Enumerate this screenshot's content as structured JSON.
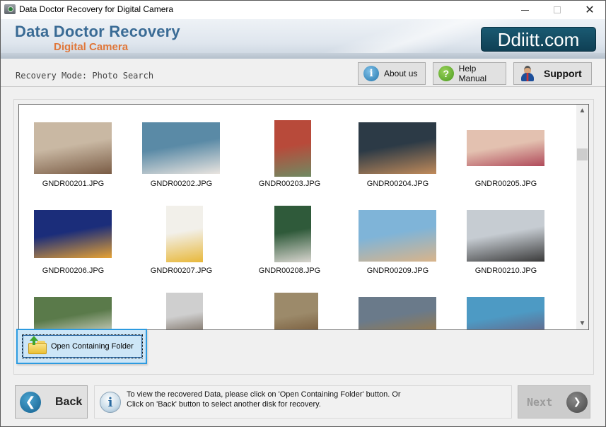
{
  "window": {
    "title": "Data Doctor Recovery for Digital Camera",
    "controls": {
      "minimize": "minimize",
      "maximize": "maximize",
      "close": "✕"
    }
  },
  "banner": {
    "title": "Data Doctor Recovery",
    "subtitle": "Digital Camera",
    "logo": "Ddiitt.com",
    "colors": {
      "title": "#3a6b95",
      "subtitle": "#e0773a",
      "logo_bg": "#134a61"
    }
  },
  "modebar": {
    "label": "Recovery Mode: Photo Search",
    "buttons": {
      "about": {
        "label": "About us",
        "icon": "info-icon",
        "glyph": "i"
      },
      "help": {
        "label": "Help Manual",
        "icon": "question-icon",
        "glyph": "?"
      },
      "support": {
        "label": "Support",
        "icon": "support-person-icon"
      }
    }
  },
  "gallery": {
    "items": [
      {
        "name": "GNDR00201.JPG",
        "scene": "group cheering in office"
      },
      {
        "name": "GNDR00202.JPG",
        "scene": "photographer on beach by lake"
      },
      {
        "name": "GNDR00203.JPG",
        "scene": "woman near red building"
      },
      {
        "name": "GNDR00204.JPG",
        "scene": "friends smiling selfie"
      },
      {
        "name": "GNDR00205.JPG",
        "scene": "four women selfie"
      },
      {
        "name": "GNDR00206.JPG",
        "scene": "city skyline at night"
      },
      {
        "name": "GNDR00207.JPG",
        "scene": "child with yay balloons"
      },
      {
        "name": "GNDR00208.JPG",
        "scene": "christmas tree"
      },
      {
        "name": "GNDR00209.JPG",
        "scene": "friends toasting on beach"
      },
      {
        "name": "GNDR00210.JPG",
        "scene": "couple sitting on rocks"
      },
      {
        "name": "",
        "scene": "group walking on beach"
      },
      {
        "name": "",
        "scene": "street with buildings"
      },
      {
        "name": "",
        "scene": "man sitting on stairs"
      },
      {
        "name": "",
        "scene": "group posing outdoors"
      },
      {
        "name": "",
        "scene": "yoga by the sea"
      }
    ],
    "scroll_position": 0.2
  },
  "open_folder_button": {
    "label": "Open Containing Folder",
    "icon": "folder-open-icon"
  },
  "footer": {
    "back_label": "Back",
    "next_label": "Next",
    "info_line1": "To view the recovered Data, please click on 'Open Containing Folder' button. Or",
    "info_line2": "Click on 'Back' button to select another disk for recovery."
  }
}
